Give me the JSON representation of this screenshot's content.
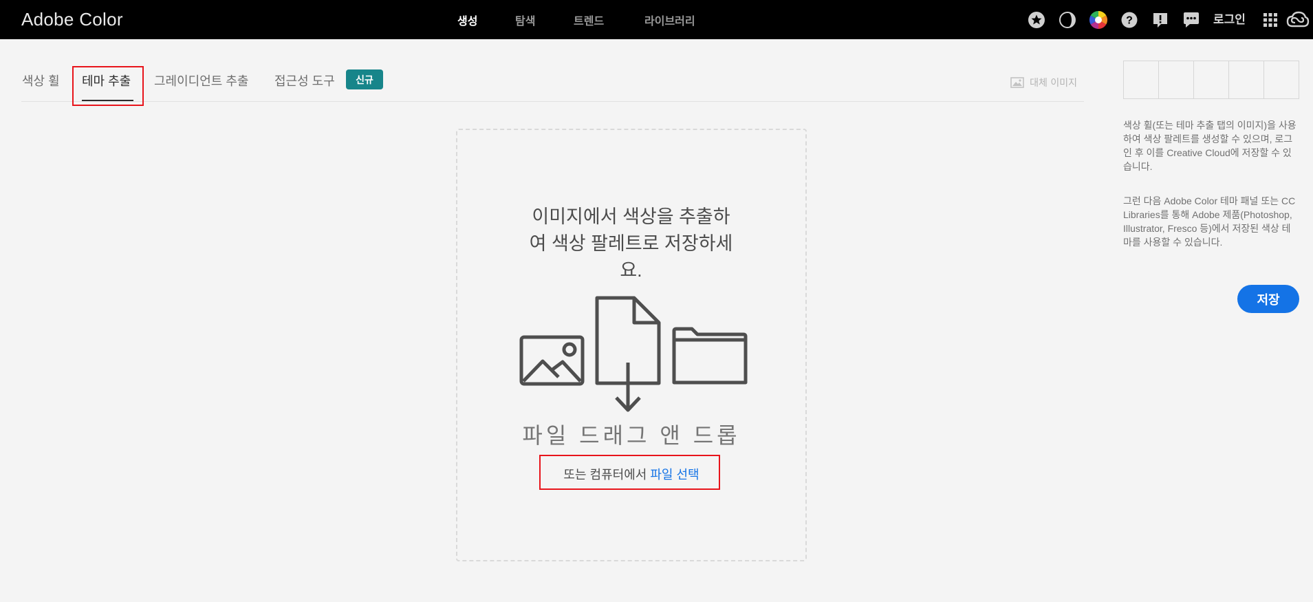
{
  "app": {
    "title": "Adobe Color"
  },
  "topnav": {
    "items": [
      {
        "label": "생성",
        "active": true
      },
      {
        "label": "탐색",
        "active": false
      },
      {
        "label": "트렌드",
        "active": false
      },
      {
        "label": "라이브러리",
        "active": false
      }
    ],
    "icons": [
      "star-icon",
      "contrast-icon",
      "color-wheel-icon",
      "help-icon",
      "feedback-icon",
      "chat-icon",
      "apps-grid-icon",
      "creative-cloud-icon"
    ],
    "login_label": "로그인"
  },
  "tabs": {
    "items": [
      {
        "label": "색상 휠",
        "active": false
      },
      {
        "label": "테마 추출",
        "active": true
      },
      {
        "label": "그레이디언트 추출",
        "active": false
      },
      {
        "label": "접근성 도구",
        "active": false
      }
    ],
    "new_badge": "신규",
    "alt_image_label": "대체 이미지"
  },
  "dropzone": {
    "heading_line1": "이미지에서 색상을 추출하",
    "heading_line2": "여 색상 팔레트로 저장하세",
    "heading_line3": "요.",
    "title": "파일 드래그 앤 드롭",
    "sub_prefix": "또는 컴퓨터에서 ",
    "sub_link": "파일 선택"
  },
  "panel": {
    "swatches": [
      "",
      "",
      "",
      "",
      ""
    ],
    "text1": "색상 휠(또는 테마 추출 탭의 이미지)을 사용하여 색상 팔레트를 생성할 수 있으며, 로그인 후 이를 Creative Cloud에 저장할 수 있습니다.",
    "text2": "그런 다음 Adobe Color 테마 패널 또는 CC Libraries를 통해 Adobe 제품(Photoshop, Illustrator, Fresco 등)에서 저장된 색상 테마를 사용할 수 있습니다.",
    "save_label": "저장"
  },
  "colors": {
    "topbar": "#000000",
    "accent_blue": "#1473e6",
    "badge_teal": "#17858a",
    "highlight_red": "#e8141b"
  }
}
